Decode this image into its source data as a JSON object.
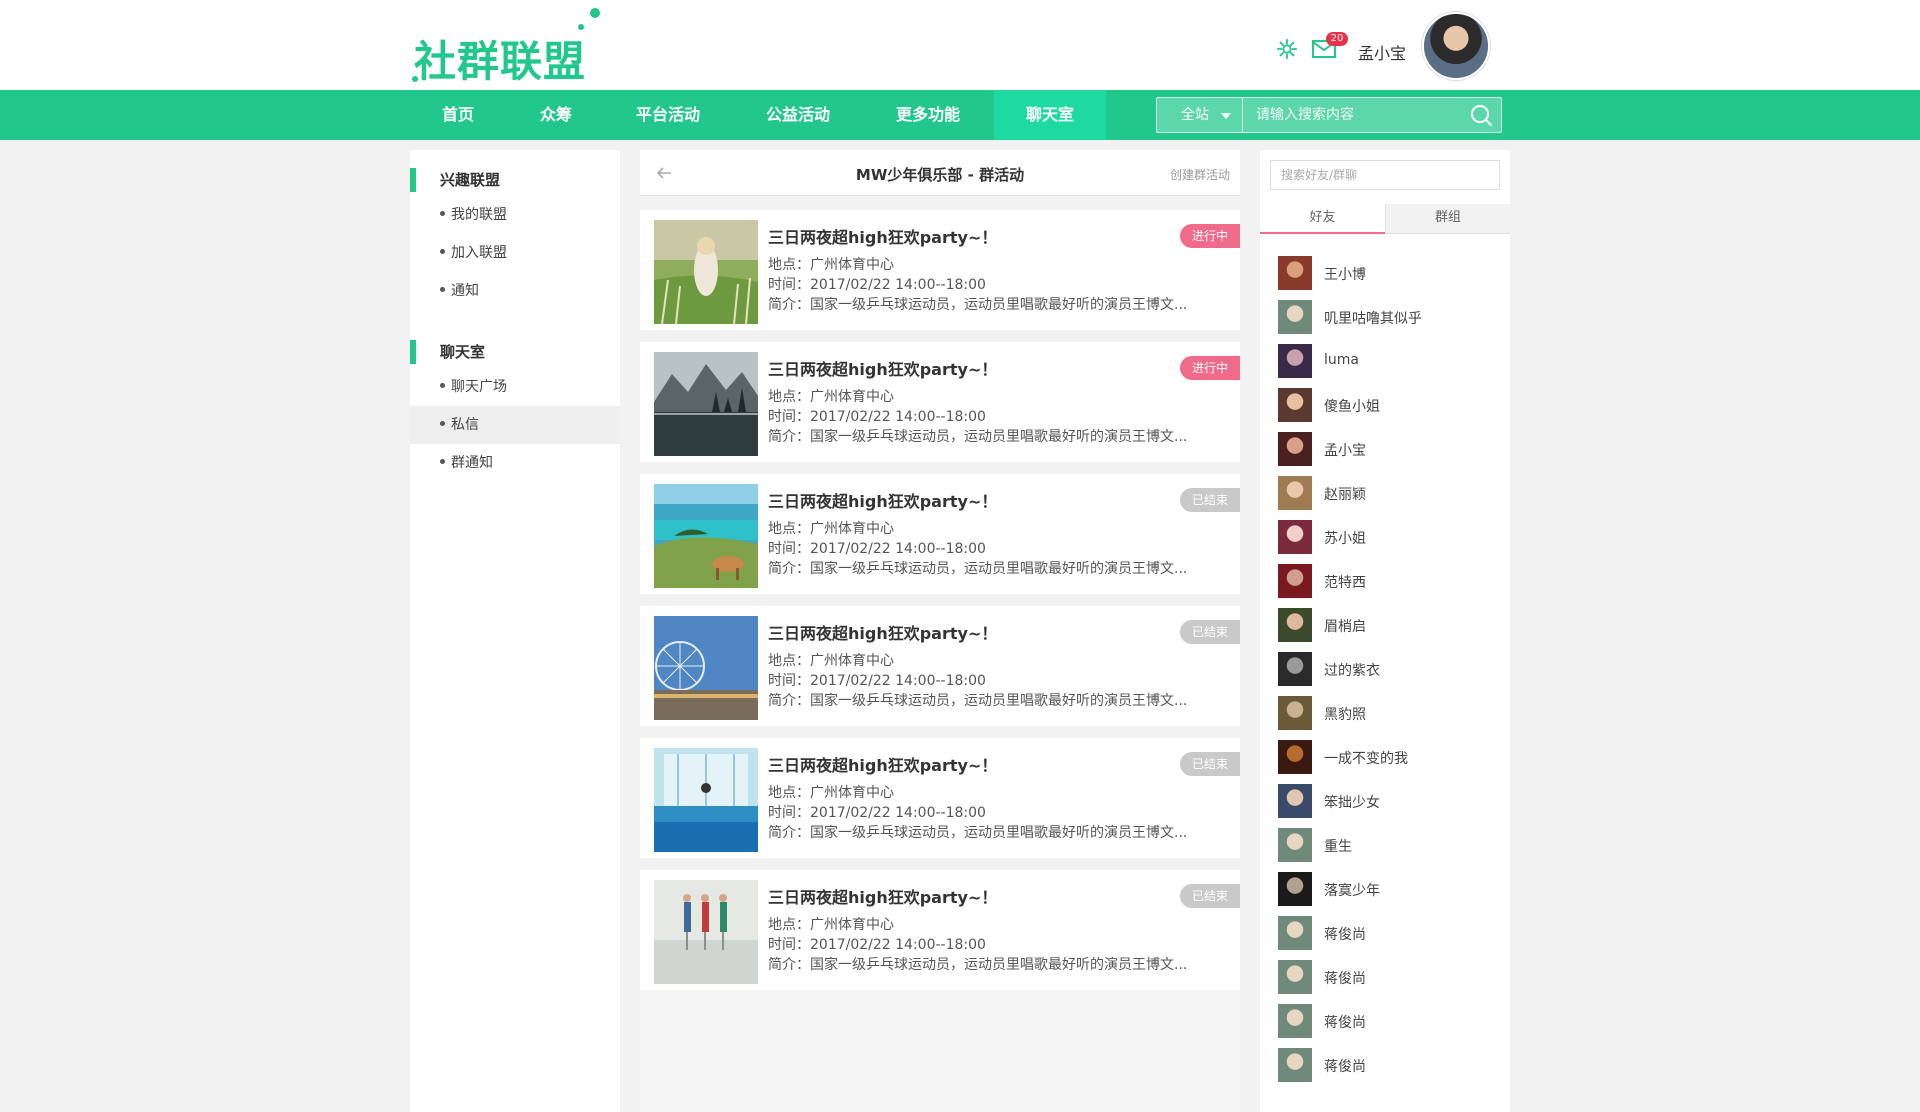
{
  "header": {
    "logo_text": "社群联盟",
    "mail_count": "20",
    "username": "孟小宝"
  },
  "nav": {
    "items": [
      "首页",
      "众筹",
      "平台活动",
      "公益活动",
      "更多功能",
      "聊天室"
    ],
    "active_index": 5,
    "search_scope": "全站",
    "search_placeholder": "请输入搜索内容"
  },
  "sidebar": {
    "groups": [
      {
        "title": "兴趣联盟",
        "items": [
          "我的联盟",
          "加入联盟",
          "通知"
        ]
      },
      {
        "title": "聊天室",
        "items": [
          "聊天广场",
          "私信",
          "群通知"
        ]
      }
    ],
    "active_item": "私信"
  },
  "main": {
    "title": "MW少年俱乐部 - 群活动",
    "create_label": "创建群活动",
    "activities": [
      {
        "title": "三日两夜超high狂欢party~！",
        "location": "地点：广州体育中心",
        "time": "时间：2017/02/22  14:00--18:00",
        "intro": "简介：国家一级乒乓球运动员，运动员里唱歌最好听的演员王博文...",
        "status": "进行中",
        "status_type": "on",
        "image": "field-girl"
      },
      {
        "title": "三日两夜超high狂欢party~！",
        "location": "地点：广州体育中心",
        "time": "时间：2017/02/22  14:00--18:00",
        "intro": "简介：国家一级乒乓球运动员，运动员里唱歌最好听的演员王博文...",
        "status": "进行中",
        "status_type": "on",
        "image": "mountain-lake"
      },
      {
        "title": "三日两夜超high狂欢party~！",
        "location": "地点：广州体育中心",
        "time": "时间：2017/02/22  14:00--18:00",
        "intro": "简介：国家一级乒乓球运动员，运动员里唱歌最好听的演员王博文...",
        "status": "已结束",
        "status_type": "off",
        "image": "coast-cow"
      },
      {
        "title": "三日两夜超high狂欢party~！",
        "location": "地点：广州体育中心",
        "time": "时间：2017/02/22  14:00--18:00",
        "intro": "简介：国家一级乒乓球运动员，运动员里唱歌最好听的演员王博文...",
        "status": "已结束",
        "status_type": "off",
        "image": "ferris-wheel"
      },
      {
        "title": "三日两夜超high狂欢party~！",
        "location": "地点：广州体育中心",
        "time": "时间：2017/02/22  14:00--18:00",
        "intro": "简介：国家一级乒乓球运动员，运动员里唱歌最好听的演员王博文...",
        "status": "已结束",
        "status_type": "off",
        "image": "swimming-pool"
      },
      {
        "title": "三日两夜超high狂欢party~！",
        "location": "地点：广州体育中心",
        "time": "时间：2017/02/22  14:00--18:00",
        "intro": "简介：国家一级乒乓球运动员，运动员里唱歌最好听的演员王博文...",
        "status": "已结束",
        "status_type": "off",
        "image": "divers"
      }
    ]
  },
  "right": {
    "search_placeholder": "搜索好友/群聊",
    "tabs": [
      "好友",
      "群组"
    ],
    "active_tab": 0,
    "friends": [
      "王小博",
      "叽里咕噜其似乎",
      "luma",
      "傻鱼小姐",
      "孟小宝",
      "赵丽颖",
      "苏小姐",
      "范特西",
      "眉梢启",
      "过的紫衣",
      "黑豹照",
      "一成不变的我",
      "笨拙少女",
      "重生",
      "落寞少年",
      "蒋俊尚",
      "蒋俊尚",
      "蒋俊尚",
      "蒋俊尚"
    ]
  },
  "colors": {
    "brand": "#21c78b",
    "nav_active": "#1ed9a0",
    "status_on": "#f06b8a",
    "status_off": "#c9c9c9",
    "badge": "#e8334a"
  },
  "icons": {
    "settings": "gear-icon",
    "mail": "mail-icon",
    "search": "search-icon",
    "back": "arrow-left-icon",
    "dropdown": "caret-down-icon"
  }
}
